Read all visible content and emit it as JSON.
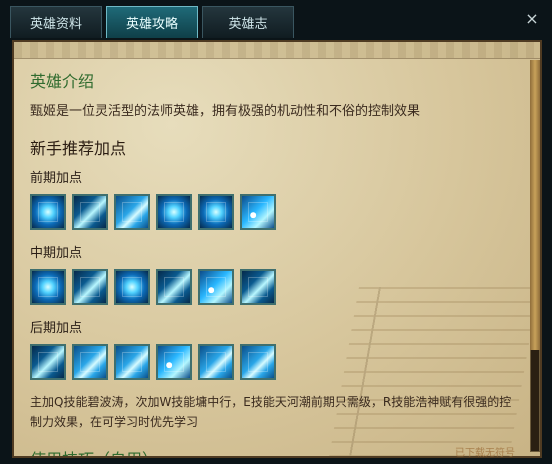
{
  "tabs": [
    {
      "label": "英雄资料",
      "active": false
    },
    {
      "label": "英雄攻略",
      "active": true
    },
    {
      "label": "英雄志",
      "active": false
    }
  ],
  "close_symbol": "×",
  "section1_title": "英雄介绍",
  "section1_text": "甄姬是一位灵活型的法师英雄，拥有极强的机动性和不俗的控制效果",
  "section2_title": "新手推荐加点",
  "groups": [
    {
      "label": "前期加点",
      "skills": [
        "Q",
        "W",
        "E",
        "Q",
        "Q",
        "R"
      ]
    },
    {
      "label": "中期加点",
      "skills": [
        "Q",
        "W",
        "Q",
        "W",
        "R",
        "W"
      ]
    },
    {
      "label": "后期加点",
      "skills": [
        "W",
        "E",
        "E",
        "R",
        "E",
        "E"
      ]
    }
  ],
  "tip_text": "主加Q技能碧波涛，次加W技能墉中行，E技能天河潮前期只需级，R技能浩神赋有很强的控制力效果，在可学习时优先学习",
  "section3_title": "使用技巧（自用）",
  "watermark": "已下载无符号",
  "colors": {
    "panel_border": "#4f3b22",
    "title_green": "#2f6b2e",
    "tab_active": "#1f6a78"
  }
}
